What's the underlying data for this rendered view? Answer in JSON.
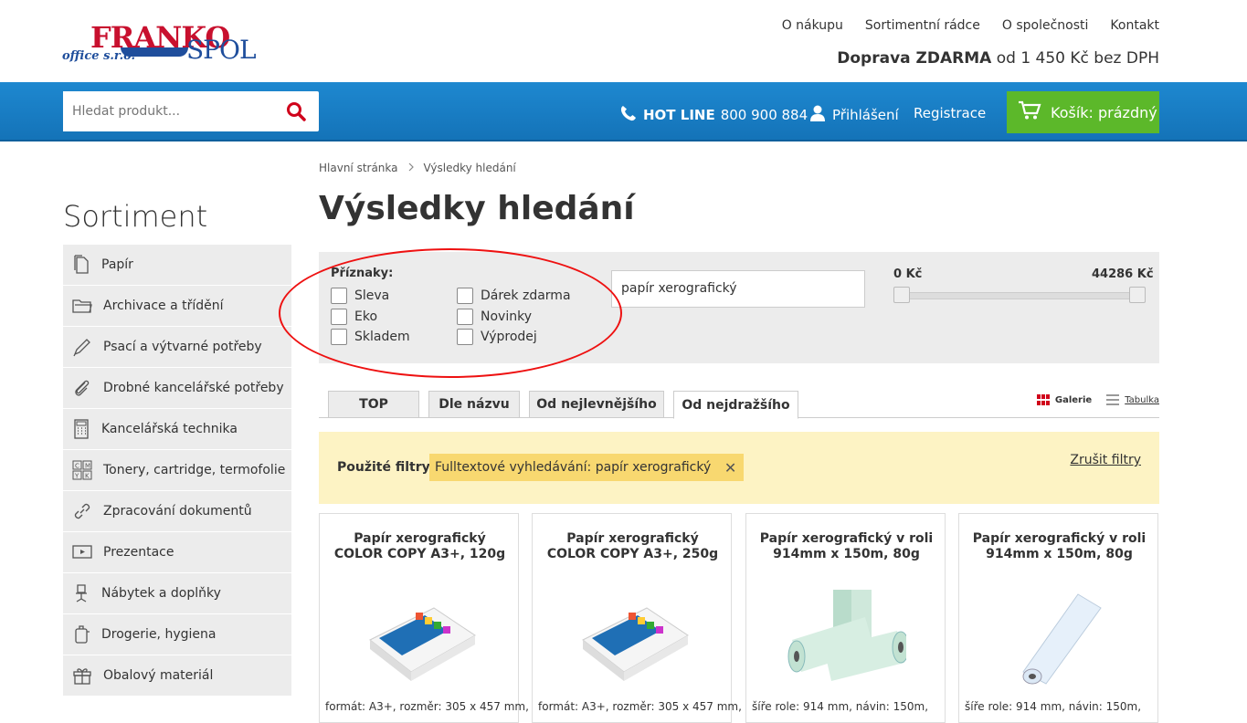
{
  "header": {
    "logo": {
      "main": "FRANKO",
      "secondary": "SPOL",
      "sub": "office s.r.o."
    },
    "top_links": [
      "O nákupu",
      "Sortimentní rádce",
      "O společnosti",
      "Kontakt"
    ],
    "shipping_bold": "Doprava ZDARMA",
    "shipping_rest": "od 1 450 Kč bez DPH"
  },
  "navbar": {
    "search_placeholder": "Hledat produkt...",
    "hotline_label": "HOT LINE",
    "hotline_number": "800 900 884",
    "login": "Přihlášení",
    "register": "Registrace",
    "cart": "Košík: prázdný",
    "accent": "#1e88d0",
    "cart_color": "#5cb82a"
  },
  "sidebar": {
    "title": "Sortiment",
    "items": [
      {
        "label": "Papír",
        "icon": "paper-icon"
      },
      {
        "label": "Archivace a třídění",
        "icon": "folder-icon"
      },
      {
        "label": "Psací a výtvarné potřeby",
        "icon": "pen-icon"
      },
      {
        "label": "Drobné kancelářské potřeby",
        "icon": "paperclip-icon"
      },
      {
        "label": "Kancelářská technika",
        "icon": "calculator-icon"
      },
      {
        "label": "Tonery, cartridge, termofolie",
        "icon": "toner-icon"
      },
      {
        "label": "Zpracování dokumentů",
        "icon": "link-icon"
      },
      {
        "label": "Prezentace",
        "icon": "presentation-icon"
      },
      {
        "label": "Nábytek a doplňky",
        "icon": "chair-icon"
      },
      {
        "label": "Drogerie, hygiena",
        "icon": "hygiene-icon"
      },
      {
        "label": "Obalový materiál",
        "icon": "gift-icon"
      }
    ]
  },
  "breadcrumb": {
    "home": "Hlavní stránka",
    "current": "Výsledky hledání"
  },
  "page_title": "Výsledky hledání",
  "filters": {
    "label": "Příznaky:",
    "checkboxes_left": [
      "Sleva",
      "Eko",
      "Skladem"
    ],
    "checkboxes_right": [
      "Dárek zdarma",
      "Novinky",
      "Výprodej"
    ],
    "fulltext_value": "papír xerografický",
    "price_min": "0 Kč",
    "price_max": "44286 Kč"
  },
  "sort_tabs": [
    "TOP",
    "Dle názvu",
    "Od nejlevnějšího",
    "Od nejdražšího"
  ],
  "active_tab": "Od nejdražšího",
  "views": {
    "gallery": "Galerie",
    "table": "Tabulka"
  },
  "applied_filters": {
    "label": "Použité filtry:",
    "chip": "Fulltextové vyhledávání: papír xerografický",
    "clear": "Zrušit filtry"
  },
  "products": [
    {
      "name": "Papír xerografický COLOR COPY A3+, 120g",
      "desc": "formát: A3+, rozměr: 305 x 457 mm,"
    },
    {
      "name": "Papír xerografický COLOR COPY A3+, 250g",
      "desc": "formát: A3+, rozměr: 305 x 457 mm,"
    },
    {
      "name": "Papír xerografický v roli 914mm x 150m, 80g",
      "desc": "šíře role: 914 mm, návin: 150m,"
    },
    {
      "name": "Papír xerografický v roli 914mm x 150m, 80g",
      "desc": "šíře role: 914 mm, návin: 150m,"
    }
  ]
}
